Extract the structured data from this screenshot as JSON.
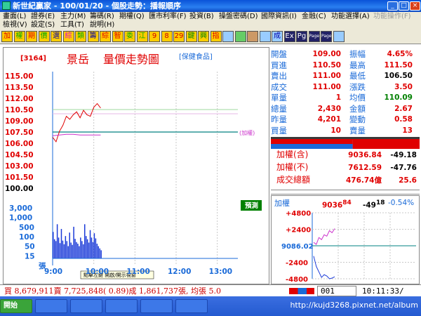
{
  "window": {
    "title": "新世紀贏家 - 100/01/20 - 個股走勢：播報順序",
    "minimize": "_",
    "maximize": "□",
    "close": "×"
  },
  "menus": [
    {
      "label": "畫面(L)",
      "enabled": true
    },
    {
      "label": "證券(E)",
      "enabled": true
    },
    {
      "label": "主力(M)",
      "enabled": true
    },
    {
      "label": "籌碼(R)",
      "enabled": true
    },
    {
      "label": "期權(Q)",
      "enabled": true
    },
    {
      "label": "匯市利率(F)",
      "enabled": true
    },
    {
      "label": "投資(B)",
      "enabled": true
    },
    {
      "label": "操盤密碼(D)",
      "enabled": true
    },
    {
      "label": "國際資訊(I)",
      "enabled": true
    },
    {
      "label": "金融(C)",
      "enabled": true
    },
    {
      "label": "功能選擇(A)",
      "enabled": true
    },
    {
      "label": "功能操作(F)",
      "enabled": false
    },
    {
      "label": "檢視(V)",
      "enabled": true
    },
    {
      "label": "設定(S)",
      "enabled": true
    },
    {
      "label": "工具(T)",
      "enabled": true
    },
    {
      "label": "說明(H)",
      "enabled": true
    }
  ],
  "toolbar": [
    {
      "label": "加",
      "icon": "add-icon"
    },
    {
      "label": "權",
      "icon": "weight-icon"
    },
    {
      "label": "期",
      "icon": "futures-icon"
    },
    {
      "label": "價",
      "icon": "price-icon"
    },
    {
      "label": "選",
      "icon": "select-icon"
    },
    {
      "label": "綜",
      "icon": "composite-icon"
    },
    {
      "label": "類",
      "icon": "category-icon"
    },
    {
      "label": "籌",
      "icon": "chips-icon"
    },
    {
      "label": "綜",
      "icon": "composite2-icon"
    },
    {
      "label": "智",
      "icon": "smart-icon"
    },
    {
      "label": "委",
      "icon": "order-icon"
    },
    {
      "label": "江",
      "icon": "river-icon"
    },
    {
      "label": "9",
      "icon": "nine-icon"
    },
    {
      "label": "8",
      "icon": "eight-icon"
    },
    {
      "label": "29",
      "icon": "twentynine-icon"
    },
    {
      "label": "鍵",
      "icon": "key-icon"
    },
    {
      "label": "興",
      "icon": "prosper-icon"
    },
    {
      "label": "指",
      "icon": "index-icon"
    },
    {
      "label": "",
      "icon": "screen-icon"
    },
    {
      "label": "",
      "icon": "grid-icon"
    },
    {
      "label": "",
      "icon": "window-icon"
    },
    {
      "label": "",
      "icon": "layout-icon"
    },
    {
      "label": "成",
      "icon": "volume-icon"
    },
    {
      "label": "Ex",
      "icon": "export-icon"
    },
    {
      "label": "Pg",
      "icon": "page-icon"
    },
    {
      "label": "Page",
      "icon": "page-up-icon"
    },
    {
      "label": "Page",
      "icon": "page-down-icon"
    },
    {
      "label": "",
      "icon": "monitor-icon"
    }
  ],
  "chart": {
    "stock_code": "[3164]",
    "stock_name": "景岳",
    "chart_title": "量價走勢圖",
    "sector": "[保健食品]",
    "weighted_tag": "(加權)",
    "reveal_label": "預測",
    "tooltip": "點擊左鍵 開啟/開示視窗"
  },
  "right": {
    "quote": [
      {
        "l1": "開盤",
        "v1": "109.00",
        "l2": "振幅",
        "v2": "4.65%",
        "c2": "#e00000"
      },
      {
        "l1": "買進",
        "v1": "110.50",
        "l2": "最高",
        "v2": "111.50",
        "c2": "#e00000"
      },
      {
        "l1": "賣出",
        "v1": "111.00",
        "l2": "最低",
        "v2": "106.50",
        "c2": "#000000"
      },
      {
        "l1": "成交",
        "v1": "111.00",
        "l2": "漲跌",
        "v2": "3.50",
        "c2": "#e00000"
      },
      {
        "l1": "單量",
        "v1": "1",
        "l2": "均價",
        "v2": "110.09",
        "c2": "#008000"
      },
      {
        "l1": "總量",
        "v1": "2,430",
        "l2": "金額",
        "v2": "2.67",
        "c2": "#e00000"
      },
      {
        "l1": "昨量",
        "v1": "4,201",
        "l2": "變動",
        "v2": "0.58",
        "c2": "#e00000"
      },
      {
        "l1": "買量",
        "v1": "10",
        "l2": "賣量",
        "v2": "13",
        "c2": "#e00000"
      }
    ],
    "bid_ratio": 0.55,
    "index": [
      {
        "label": "加權(含)",
        "value": "9036.84",
        "change": "-49.18"
      },
      {
        "label": "加權(不)",
        "value": "7612.59",
        "change": "-47.76"
      },
      {
        "label": "成交總額",
        "value": "476.74億",
        "change": "25.6"
      }
    ],
    "mini": {
      "label": "加權",
      "value_main": "9036",
      "value_frac": "84",
      "change_main": "-49",
      "change_frac": "18",
      "pct": "-0.54%",
      "center_label": "9086.02"
    }
  },
  "status": {
    "summary": "買 8,679,911賣 7,725,848( 0.89)成 1,861,737張, 均張 5.0",
    "input_value": "001",
    "clock": "10:11:33/"
  },
  "taskbar": {
    "watermark": "http://kujd3268.pixnet.net/album",
    "start": "開始"
  },
  "chart_data": [
    {
      "type": "line",
      "y_tick_labels": [
        "115.00",
        "113.50",
        "112.00",
        "110.50",
        "109.00",
        "107.50",
        "106.00",
        "104.50",
        "103.00",
        "101.50",
        "100.00"
      ],
      "x_tick_labels": [
        "9:00",
        "10:00",
        "11:00",
        "12:00",
        "13:00"
      ],
      "ylim": [
        100.0,
        115.0
      ],
      "reference_price": 107.5,
      "series": [
        {
          "x": [
            "9:00",
            "9:05",
            "9:10",
            "9:15",
            "9:20",
            "9:25",
            "9:30",
            "9:35",
            "9:40",
            "9:45",
            "9:50",
            "9:55",
            "10:00",
            "10:05",
            "10:10"
          ],
          "values": [
            106.8,
            106.2,
            107.6,
            108.4,
            109.6,
            109.2,
            109.8,
            110.2,
            109.4,
            110.4,
            109.8,
            109.6,
            110.8,
            111.3,
            110.7
          ]
        },
        {
          "x": [
            "9:00",
            "9:10",
            "9:20",
            "9:30",
            "9:40",
            "9:50",
            "10:00",
            "10:10"
          ],
          "values": [
            107.0,
            107.1,
            107.2,
            107.2,
            107.1,
            107.1,
            107.1,
            107.1
          ]
        }
      ]
    },
    {
      "type": "bar",
      "y_tick_labels": [
        "3,000",
        "1,000",
        "500",
        "100",
        "50",
        "15",
        "張"
      ],
      "x_tick_labels": [
        "9:00",
        "10:00",
        "11:00",
        "12:00",
        "13:00"
      ],
      "ylim": [
        0,
        3000
      ],
      "x": [
        "9:00",
        "9:02",
        "9:04",
        "9:06",
        "9:08",
        "9:10",
        "9:12",
        "9:14",
        "9:16",
        "9:18",
        "9:20",
        "9:22",
        "9:24",
        "9:26",
        "9:28",
        "9:30",
        "9:32",
        "9:34",
        "9:36",
        "9:38",
        "9:40",
        "9:42",
        "9:44",
        "9:46",
        "9:48",
        "9:50",
        "9:52",
        "9:54",
        "9:56",
        "9:58",
        "10:00",
        "10:02",
        "10:04",
        "10:06",
        "10:08",
        "10:10"
      ],
      "values": [
        420,
        220,
        180,
        700,
        260,
        140,
        520,
        190,
        120,
        300,
        180,
        90,
        400,
        150,
        110,
        600,
        230,
        160,
        130,
        90,
        260,
        180,
        120,
        700,
        300,
        220,
        150,
        480,
        260,
        160,
        380,
        240,
        130,
        90,
        60,
        40
      ]
    },
    {
      "type": "line",
      "y_tick_labels": [
        "+4800",
        "+2400",
        "9086.02",
        "-2400",
        "-4800"
      ],
      "ylim": [
        -4800,
        4800
      ],
      "series": [
        {
          "values": [
            500,
            200,
            1200,
            900,
            1600,
            1400,
            2200,
            1900,
            2500
          ]
        },
        {
          "values": [
            -1500,
            -3000,
            -3800,
            -4600,
            -4200,
            -4400,
            -4800,
            -4700,
            -4500
          ]
        }
      ]
    }
  ]
}
